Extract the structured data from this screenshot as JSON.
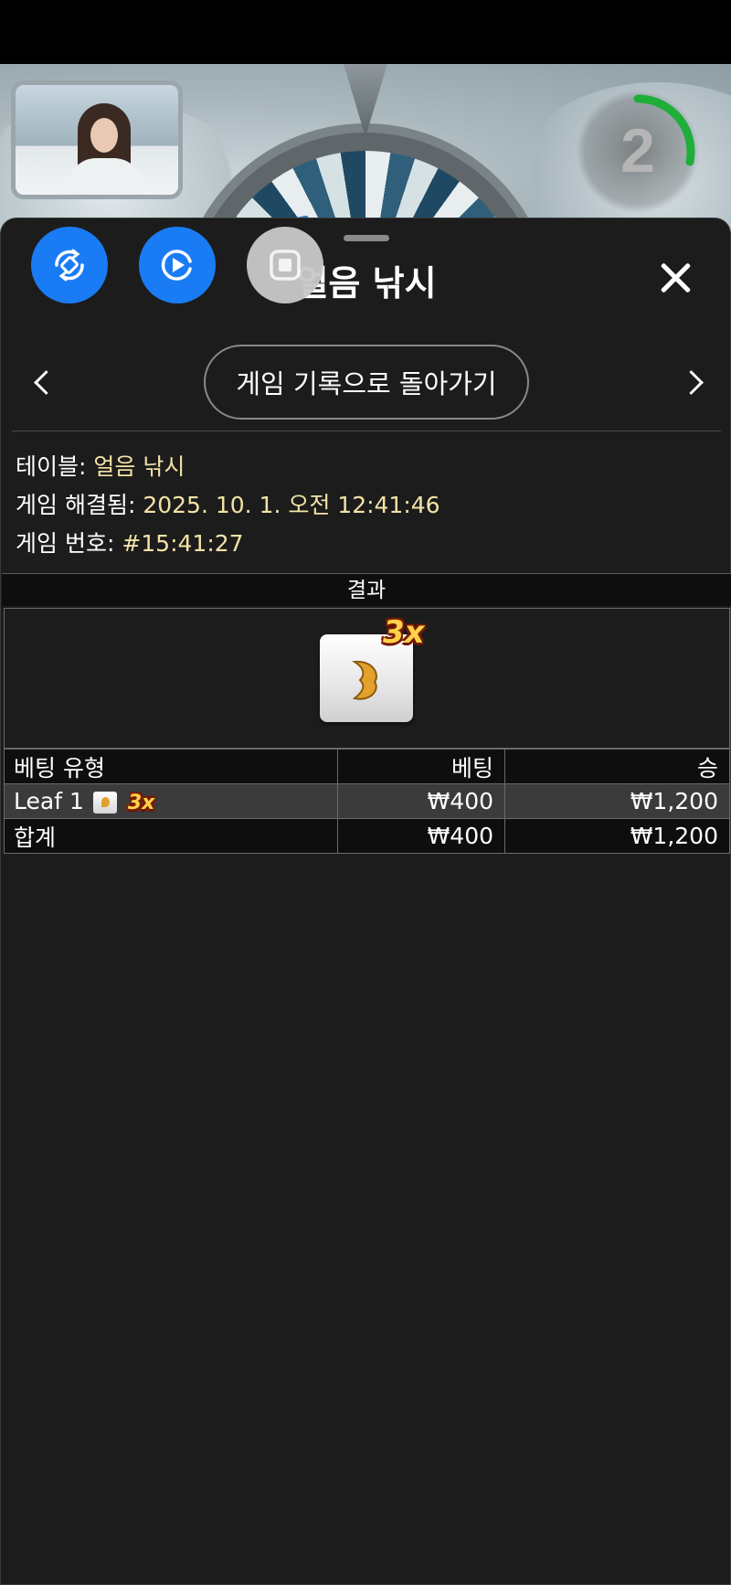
{
  "timer": {
    "value": "2",
    "progress": 0.28,
    "color": "#1fae3a"
  },
  "sheet": {
    "title": "얼음 낚시",
    "back_button": "게임 기록으로 돌아가기"
  },
  "info": {
    "table_label": "테이블: ",
    "table_value": "얼음 낚시",
    "resolved_label": "게임 해결됨: ",
    "resolved_value": "2025. 10. 1. 오전 12:41:46",
    "number_label": "게임 번호: ",
    "number_value": "#15:41:27"
  },
  "result": {
    "header": "결과",
    "multiplier": "3x",
    "symbol": "leaf-icon"
  },
  "bets_table": {
    "headers": [
      "베팅 유형",
      "베팅",
      "승"
    ],
    "rows": [
      {
        "type": "Leaf 1",
        "multiplier": "3x",
        "bet": "₩400",
        "win": "₩1,200"
      }
    ],
    "total": {
      "label": "합계",
      "bet": "₩400",
      "win": "₩1,200"
    }
  },
  "colors": {
    "accent_blue": "#1a7cf5",
    "value_text": "#f3e3a6",
    "sheet_bg": "#1c1c1c"
  },
  "icons": {
    "fab_1": "rotate-screen-icon",
    "fab_2": "screen-record-icon",
    "fab_3": "stop-record-icon"
  }
}
